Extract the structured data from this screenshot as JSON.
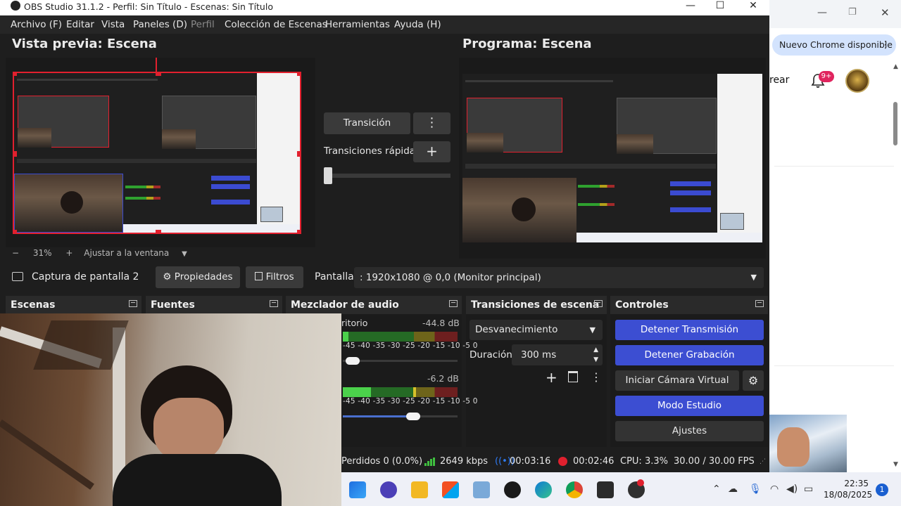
{
  "window": {
    "title": "OBS Studio 31.1.2 - Perfil: Sin Título - Escenas: Sin Título",
    "minimize": "—",
    "maximize": "☐",
    "close": "✕"
  },
  "menu": [
    "Archivo (F)",
    "Editar",
    "Vista",
    "Paneles (D)",
    "Perfil",
    "Colección de Escenas",
    "Herramientas",
    "Ayuda (H)"
  ],
  "preview": {
    "title": "Vista previa: Escena",
    "zoom_minus": "−",
    "zoom_value": "31%",
    "zoom_plus": "+",
    "fit": "Ajustar a la ventana",
    "fit_caret": "▼"
  },
  "program": {
    "title": "Programa: Escena"
  },
  "transition": {
    "button": "Transición",
    "more": "⋮",
    "quick_label": "Transiciones rápidas",
    "quick_add": "+",
    "slider_level": 0
  },
  "source_toolbar": {
    "source_name": "Captura de pantalla 2",
    "properties": "Propiedades",
    "filters": "Filtros",
    "display_label": "Pantalla",
    "display_value": ": 1920x1080 @ 0,0 (Monitor principal)"
  },
  "docks": {
    "scenes": "Escenas",
    "sources": "Fuentes",
    "mixer": "Mezclador de audio",
    "transitions": "Transiciones de escena",
    "controls": "Controles"
  },
  "mixer": {
    "channels": [
      {
        "name": "ritorio",
        "db": "-44.8 dB",
        "volume": 0.03
      },
      {
        "name": "",
        "db": "-6.2 dB",
        "volume": 0.63
      }
    ],
    "ticks": "-45 -40 -35 -30 -25 -20 -15 -10 -5 0"
  },
  "scene_transitions": {
    "type": "Desvanecimiento",
    "duration_label": "Duración",
    "duration_value": "300 ms"
  },
  "controls": {
    "stop_stream": "Detener Transmisión",
    "stop_record": "Detener Grabación",
    "virtual_cam": "Iniciar Cámara Virtual",
    "studio_mode": "Modo Estudio",
    "settings": "Ajustes"
  },
  "status": {
    "dropped": "Perdidos 0 (0.0%)",
    "bitrate": "2649 kbps",
    "stream_time": "00:03:16",
    "record_time": "00:02:46",
    "cpu": "CPU: 3.3%",
    "fps": "30.00 / 30.00 FPS"
  },
  "chrome": {
    "update": "Nuevo Chrome disponible",
    "more": "⋮",
    "create": "rear",
    "notif_count": "9+"
  },
  "taskbar": {
    "time": "22:35",
    "date": "18/08/2025",
    "notif": "1"
  },
  "colors": {
    "accent_blue": "#3c4ed2",
    "preview_border": "#e2202e",
    "stream_icon": "#2f7bf5",
    "record_icon": "#e0202e",
    "signal": "#3fbf3f"
  }
}
